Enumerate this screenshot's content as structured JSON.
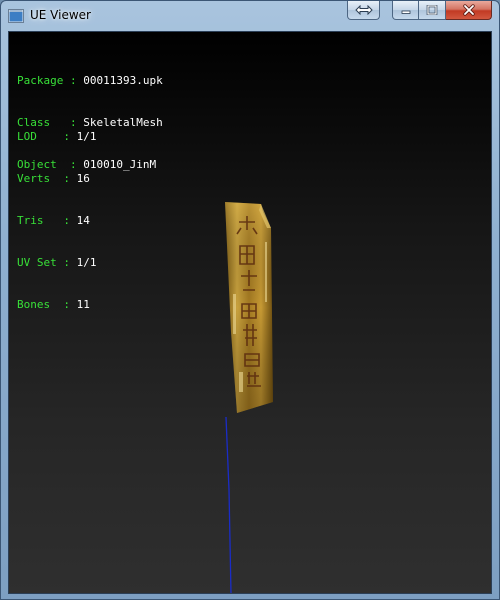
{
  "window": {
    "title": "UE Viewer"
  },
  "info_block_1": [
    {
      "key": "Package",
      "sep": ":",
      "value": "00011393.upk"
    },
    {
      "key": "Class",
      "sep": ":",
      "value": "SkeletalMesh"
    },
    {
      "key": "Object",
      "sep": ":",
      "value": "010010_JinM"
    }
  ],
  "info_block_2": [
    {
      "key": "LOD",
      "sep": ":",
      "value": "1/1"
    },
    {
      "key": "Verts",
      "sep": ":",
      "value": "16"
    },
    {
      "key": "Tris",
      "sep": ":",
      "value": "14"
    },
    {
      "key": "UV Set",
      "sep": ":",
      "value": "1/1"
    },
    {
      "key": "Bones",
      "sep": ":",
      "value": "11"
    }
  ],
  "icons": {
    "swap": "swap-arrows-icon",
    "minimize": "minimize-icon",
    "maximize": "maximize-icon",
    "close": "close-icon"
  },
  "colors": {
    "label": "#38e038",
    "value": "#ffffff",
    "viewport_bg": "#1a1a1a",
    "close_button": "#c23a24",
    "bone_line": "#1a2cc8",
    "mesh_gold": "#b08a2a"
  }
}
